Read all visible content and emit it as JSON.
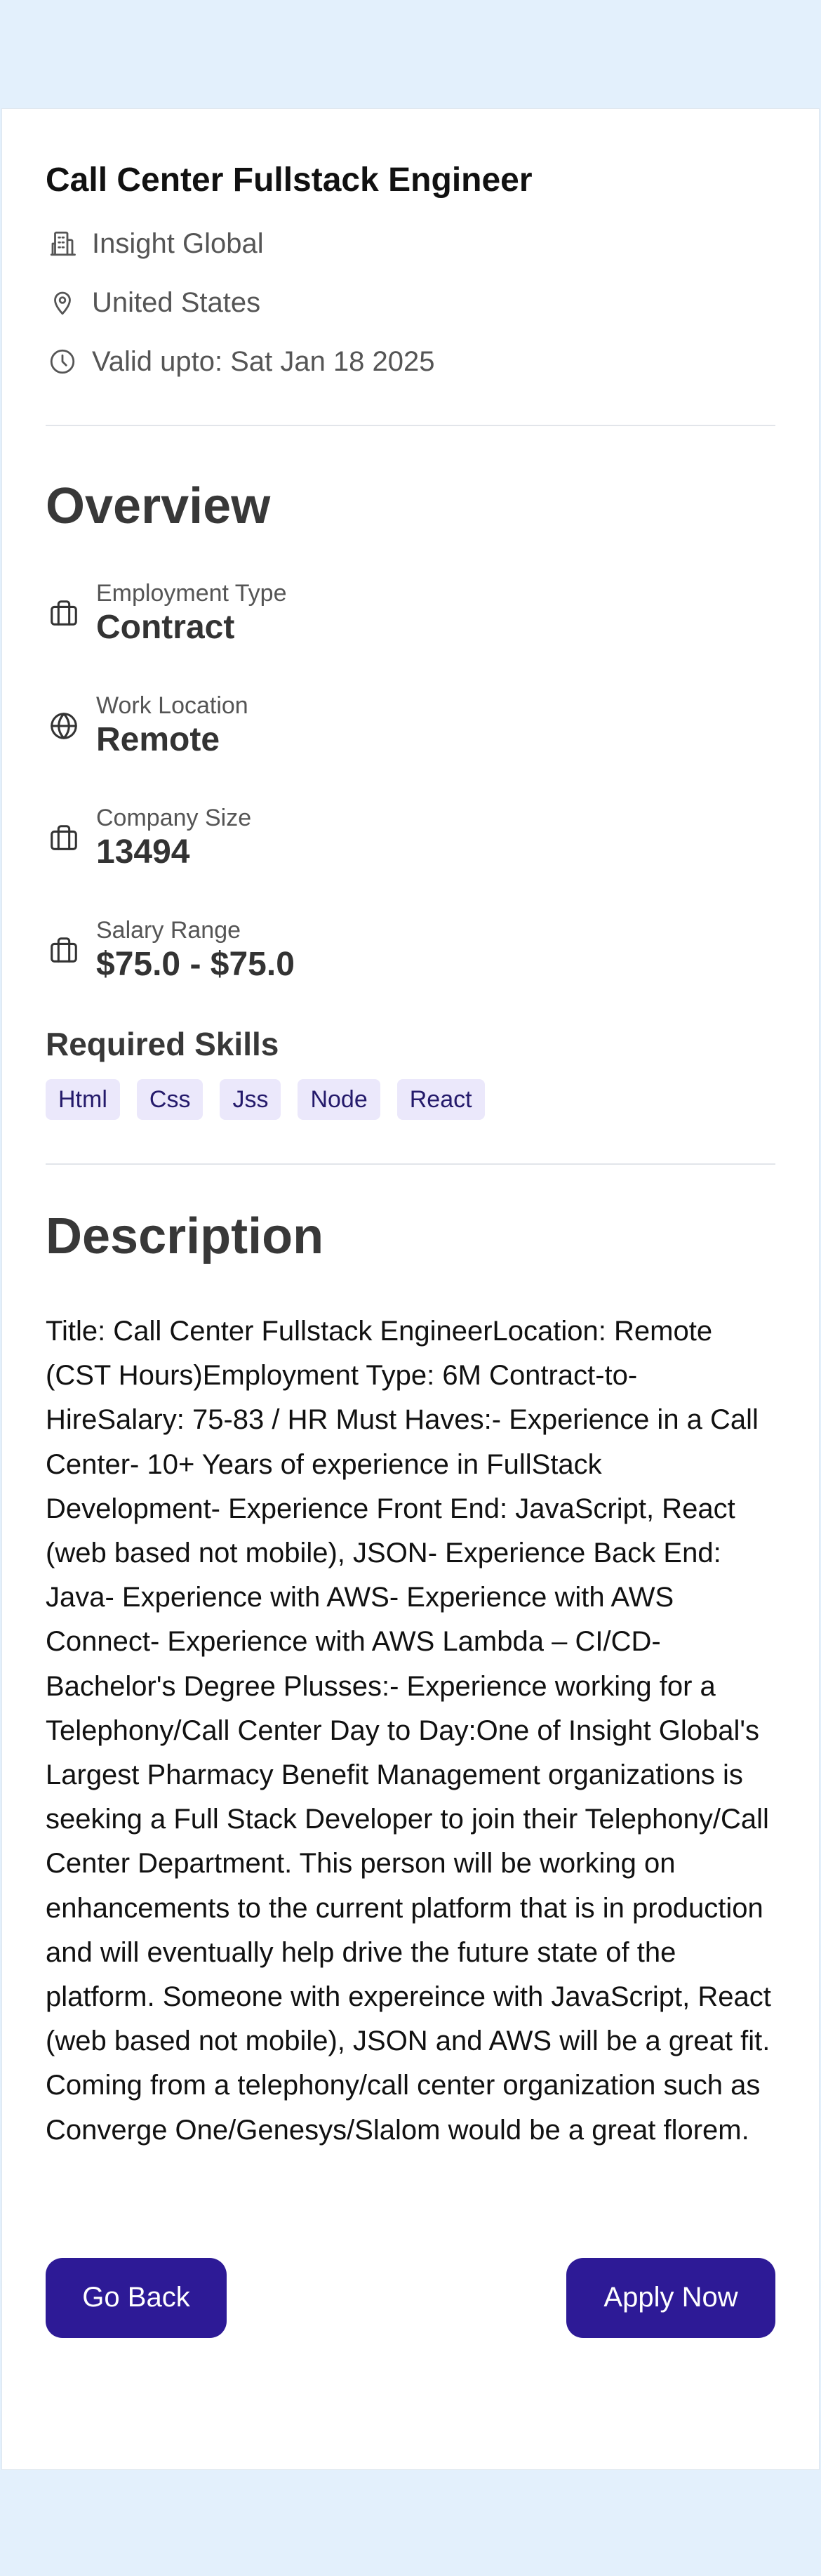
{
  "job": {
    "title": "Call Center Fullstack Engineer",
    "company": "Insight Global",
    "location": "United States",
    "valid_until": "Valid upto: Sat Jan 18 2025"
  },
  "overview": {
    "heading": "Overview",
    "items": [
      {
        "label": "Employment Type",
        "value": "Contract",
        "icon": "briefcase-icon"
      },
      {
        "label": "Work Location",
        "value": "Remote",
        "icon": "globe-icon"
      },
      {
        "label": "Company Size",
        "value": "13494",
        "icon": "briefcase-icon"
      },
      {
        "label": "Salary Range",
        "value": "$75.0 - $75.0",
        "icon": "briefcase-icon"
      }
    ]
  },
  "skills": {
    "heading": "Required Skills",
    "items": [
      "Html",
      "Css",
      "Jss",
      "Node",
      "React"
    ]
  },
  "description": {
    "heading": "Description",
    "text": "Title: Call Center Fullstack EngineerLocation: Remote (CST Hours)Employment Type: 6M Contract-to-HireSalary: 75-83 / HR Must Haves:- Experience in a Call Center- 10+ Years of experience in FullStack Development- Experience Front End: JavaScript, React (web based not mobile), JSON- Experience Back End: Java- Experience with AWS- Experience with AWS Connect- Experience with AWS Lambda – CI/CD- Bachelor's Degree Plusses:- Experience working for a Telephony/Call Center Day to Day:One of Insight Global's Largest Pharmacy Benefit Management organizations is seeking a Full Stack Developer to join their Telephony/Call Center Department. This person will be working on enhancements to the current platform that is in production and will eventually help drive the future state of the platform. Someone with expereince with JavaScript, React (web based not mobile), JSON and AWS will be a great fit. Coming from a telephony/call center organization such as Converge One/Genesys/Slalom would be a great florem."
  },
  "actions": {
    "back_label": "Go Back",
    "apply_label": "Apply Now"
  },
  "colors": {
    "page_background": "#e3f0fc",
    "button": "#2d1a96",
    "skill_chip_background": "#ebe8fb",
    "skill_chip_text": "#241a6b"
  }
}
